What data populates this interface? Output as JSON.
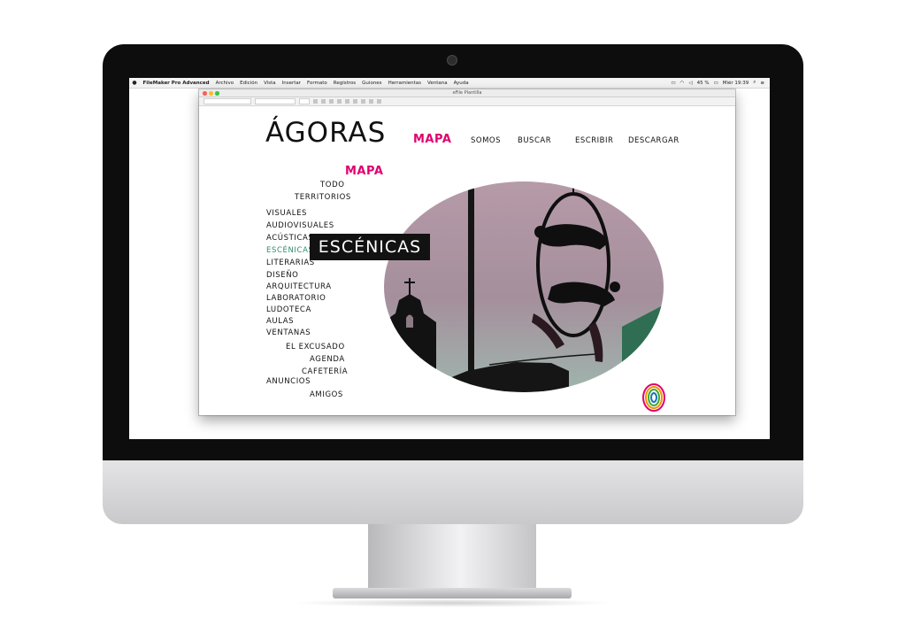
{
  "menubar": {
    "apple": "",
    "items": [
      "FileMaker Pro Advanced",
      "Archivo",
      "Edición",
      "Vista",
      "Insertar",
      "Formato",
      "Registros",
      "Guiones",
      "Herramientas",
      "Ventana",
      "Ayuda"
    ],
    "battery": "45 %",
    "clock": "Miér 19:39"
  },
  "window": {
    "title": "eFile Plantilla"
  },
  "site": {
    "logo": "ÁGORAS",
    "nav": [
      {
        "label": "MAPA",
        "active": true
      },
      {
        "label": "SOMOS",
        "active": false
      },
      {
        "label": "BUSCAR",
        "active": false
      },
      {
        "label": "ESCRIBIR",
        "active": false
      },
      {
        "label": "DESCARGAR",
        "active": false
      }
    ],
    "section_title": "MAPA",
    "categories": [
      {
        "label": "TODO"
      },
      {
        "label": "TERRITORIOS"
      },
      {
        "label": "VISUALES"
      },
      {
        "label": "AUDIOVISUALES"
      },
      {
        "label": "ACÚSTICAS"
      },
      {
        "label": "ESCÉNICAS",
        "selected": true
      },
      {
        "label": "LITERARIAS"
      },
      {
        "label": "DISEÑO"
      },
      {
        "label": "ARQUITECTURA"
      },
      {
        "label": "LABORATORIO"
      },
      {
        "label": "LUDOTECA"
      },
      {
        "label": "AULAS"
      },
      {
        "label": "VENTANAS"
      },
      {
        "label": "EL EXCUSADO"
      },
      {
        "label": "AGENDA"
      },
      {
        "label": "CAFETERÍA"
      },
      {
        "label": "ANUNCIOS"
      },
      {
        "label": "AMIGOS"
      }
    ],
    "banner": "ESCÉNICAS"
  },
  "colors": {
    "accent": "#e0006f",
    "selected": "#2f8f6c",
    "banner_bg": "#121212"
  }
}
